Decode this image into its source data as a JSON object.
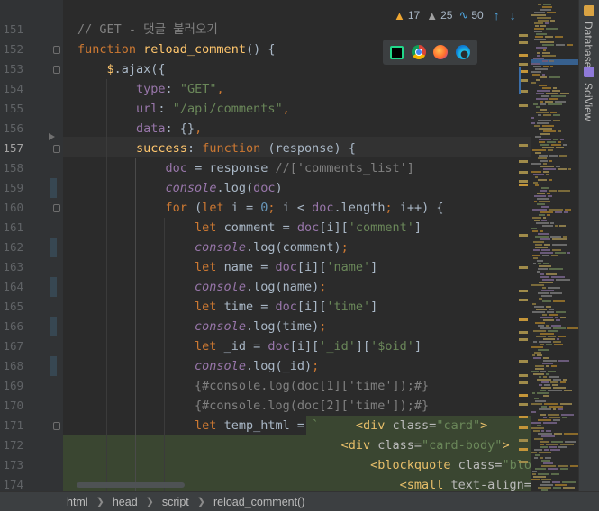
{
  "colors": {
    "keyword": "#cc7832",
    "function": "#ffc66d",
    "string": "#6a8759",
    "number": "#6897bb",
    "comment": "#808080",
    "property": "#9876aa",
    "highlight": "#3a4631"
  },
  "inspections": {
    "warnings": "17",
    "weak_warnings": "25",
    "typos": "50"
  },
  "browsers": [
    "jetbrains-icon",
    "chrome-icon",
    "firefox-icon",
    "edge-icon"
  ],
  "right_tools": {
    "database": "Database",
    "sciview": "SciView"
  },
  "breadcrumb": [
    "html",
    "head",
    "script",
    "reload_comment()"
  ],
  "current_line": "157",
  "lines": [
    {
      "n": "151",
      "t": [
        [
          "com",
          "// GET - 댓글 불러오기"
        ]
      ]
    },
    {
      "n": "152",
      "t": [
        [
          "kw",
          "function "
        ],
        [
          "fn",
          "reload_comment"
        ],
        [
          "",
          "() {"
        ]
      ]
    },
    {
      "n": "153",
      "t": [
        [
          "",
          "    "
        ],
        [
          "fn",
          "$"
        ],
        [
          "",
          ".ajax({"
        ]
      ]
    },
    {
      "n": "154",
      "t": [
        [
          "",
          "        "
        ],
        [
          "prop",
          "type"
        ],
        [
          "",
          ": "
        ],
        [
          "str",
          "\"GET\""
        ],
        [
          "kw",
          ","
        ]
      ]
    },
    {
      "n": "155",
      "t": [
        [
          "",
          "        "
        ],
        [
          "prop",
          "url"
        ],
        [
          "",
          ": "
        ],
        [
          "str",
          "\"/api/comments\""
        ],
        [
          "kw",
          ","
        ]
      ]
    },
    {
      "n": "156",
      "t": [
        [
          "",
          "        "
        ],
        [
          "prop",
          "data"
        ],
        [
          "",
          ": {}"
        ],
        [
          "kw",
          ","
        ]
      ]
    },
    {
      "n": "157",
      "t": [
        [
          "",
          "        "
        ],
        [
          "fn",
          "success"
        ],
        [
          "",
          ": "
        ],
        [
          "kw",
          "function "
        ],
        [
          "",
          "(response) {"
        ]
      ]
    },
    {
      "n": "158",
      "t": [
        [
          "",
          "            "
        ],
        [
          "prop",
          "doc"
        ],
        [
          "",
          " = response "
        ],
        [
          "com",
          "//['comments_list']"
        ]
      ]
    },
    {
      "n": "159",
      "t": [
        [
          "",
          "            "
        ],
        [
          "ital",
          "console"
        ],
        [
          "",
          ".log("
        ],
        [
          "prop",
          "doc"
        ],
        [
          "",
          ")"
        ]
      ]
    },
    {
      "n": "160",
      "t": [
        [
          "",
          "            "
        ],
        [
          "kw",
          "for "
        ],
        [
          "",
          "("
        ],
        [
          "kw",
          "let "
        ],
        [
          "",
          "i = "
        ],
        [
          "num",
          "0"
        ],
        [
          "kw",
          "; "
        ],
        [
          "",
          "i < "
        ],
        [
          "prop",
          "doc"
        ],
        [
          "",
          ".length"
        ],
        [
          "kw",
          "; "
        ],
        [
          "",
          "i++) {"
        ]
      ]
    },
    {
      "n": "161",
      "t": [
        [
          "",
          "                "
        ],
        [
          "kw",
          "let "
        ],
        [
          "",
          "comment = "
        ],
        [
          "prop",
          "doc"
        ],
        [
          "",
          "[i]["
        ],
        [
          "str",
          "'comment'"
        ],
        [
          "",
          "]"
        ]
      ]
    },
    {
      "n": "162",
      "t": [
        [
          "",
          "                "
        ],
        [
          "ital",
          "console"
        ],
        [
          "",
          ".log(comment)"
        ],
        [
          "kw",
          ";"
        ]
      ]
    },
    {
      "n": "163",
      "t": [
        [
          "",
          "                "
        ],
        [
          "kw",
          "let "
        ],
        [
          "",
          "name = "
        ],
        [
          "prop",
          "doc"
        ],
        [
          "",
          "[i]["
        ],
        [
          "str",
          "'name'"
        ],
        [
          "",
          "]"
        ]
      ]
    },
    {
      "n": "164",
      "t": [
        [
          "",
          "                "
        ],
        [
          "ital",
          "console"
        ],
        [
          "",
          ".log(name)"
        ],
        [
          "kw",
          ";"
        ]
      ]
    },
    {
      "n": "165",
      "t": [
        [
          "",
          "                "
        ],
        [
          "kw",
          "let "
        ],
        [
          "",
          "time = "
        ],
        [
          "prop",
          "doc"
        ],
        [
          "",
          "[i]["
        ],
        [
          "str",
          "'time'"
        ],
        [
          "",
          "]"
        ]
      ]
    },
    {
      "n": "166",
      "t": [
        [
          "",
          "                "
        ],
        [
          "ital",
          "console"
        ],
        [
          "",
          ".log(time)"
        ],
        [
          "kw",
          ";"
        ]
      ]
    },
    {
      "n": "167",
      "t": [
        [
          "",
          "                "
        ],
        [
          "kw",
          "let "
        ],
        [
          "",
          "_id = "
        ],
        [
          "prop",
          "doc"
        ],
        [
          "",
          "[i]["
        ],
        [
          "str",
          "'_id'"
        ],
        [
          "",
          "]["
        ],
        [
          "str",
          "'$oid'"
        ],
        [
          "",
          "]"
        ]
      ]
    },
    {
      "n": "168",
      "t": [
        [
          "",
          "                "
        ],
        [
          "ital",
          "console"
        ],
        [
          "",
          ".log(_id)"
        ],
        [
          "kw",
          ";"
        ]
      ]
    },
    {
      "n": "169",
      "t": [
        [
          "",
          "                "
        ],
        [
          "com",
          "{#console.log(doc[1]['time']);#}"
        ]
      ]
    },
    {
      "n": "170",
      "t": [
        [
          "",
          "                "
        ],
        [
          "com",
          "{#console.log(doc[2]['time']);#}"
        ]
      ]
    },
    {
      "n": "171",
      "t": [
        [
          "",
          "                "
        ],
        [
          "kw",
          "let "
        ],
        [
          "",
          "temp_html = "
        ],
        [
          "str",
          "` "
        ],
        [
          "tpl",
          "    "
        ],
        [
          "tag",
          "<div "
        ],
        [
          "attr",
          "class="
        ],
        [
          "str",
          "\"card\""
        ],
        [
          "tag",
          ">"
        ]
      ]
    },
    {
      "n": "172",
      "t": [
        [
          "tpl",
          "                                    "
        ],
        [
          "tag",
          "<div "
        ],
        [
          "attr",
          "class="
        ],
        [
          "str",
          "\"card-body\""
        ],
        [
          "tag",
          ">"
        ]
      ]
    },
    {
      "n": "173",
      "t": [
        [
          "tpl",
          "                                        "
        ],
        [
          "tag",
          "<blockquote "
        ],
        [
          "attr",
          "class="
        ],
        [
          "str",
          "\"blockquote"
        ]
      ]
    },
    {
      "n": "174",
      "t": [
        [
          "tpl",
          "                                            "
        ],
        [
          "tag",
          "<small "
        ],
        [
          "attr",
          "text-align="
        ],
        [
          "str",
          "\"righ"
        ]
      ]
    }
  ]
}
